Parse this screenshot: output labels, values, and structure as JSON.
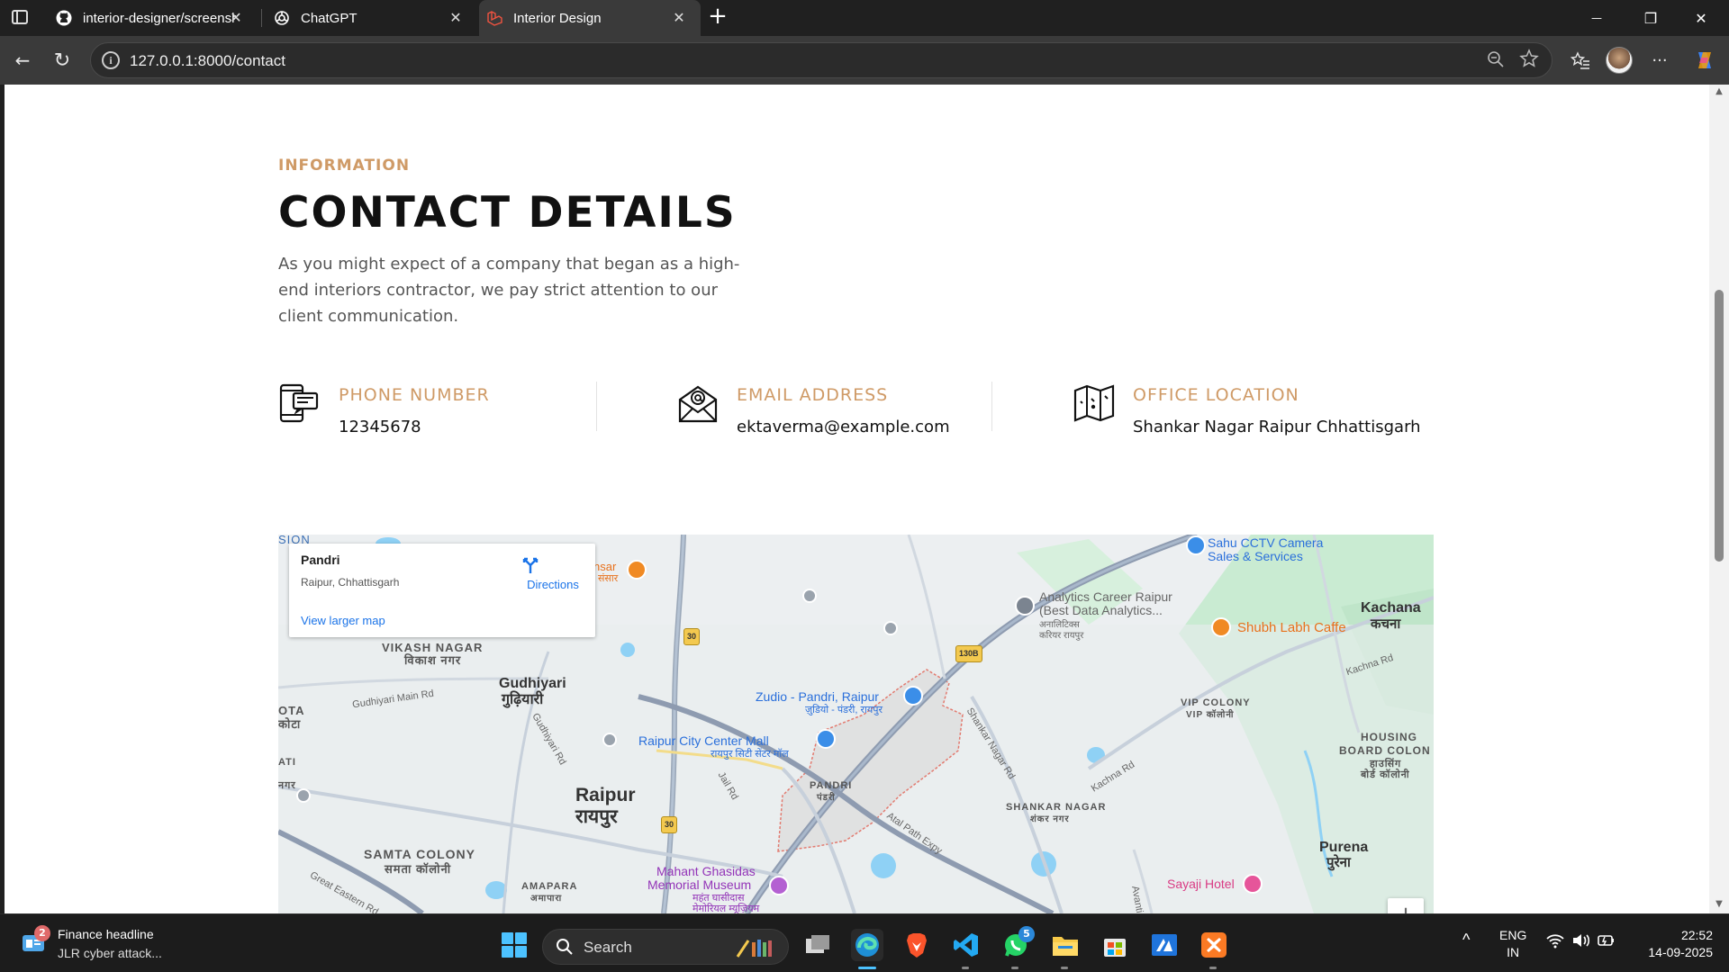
{
  "browser": {
    "tabs": [
      {
        "title": "interior-designer/screenshorts/Sc",
        "icon": "github-icon"
      },
      {
        "title": "ChatGPT",
        "icon": "chatgpt-icon"
      },
      {
        "title": "Interior Design",
        "icon": "laravel-icon"
      }
    ],
    "new_tab": "+",
    "url": "127.0.0.1:8000/contact",
    "window_controls": {
      "minimize": "—",
      "restore": "❐",
      "close": "✕"
    },
    "tab_close": "✕",
    "toolbar_icons": {
      "back": "←",
      "reload": "↻",
      "menu": "···"
    }
  },
  "page": {
    "eyebrow": "INFORMATION",
    "heading": "CONTACT DETAILS",
    "intro": "As you might expect of a company that began as a high-end interiors contractor, we pay strict attention to our client communication.",
    "contacts": [
      {
        "label": "PHONE NUMBER",
        "value": "12345678",
        "icon": "phone-icon"
      },
      {
        "label": "EMAIL ADDRESS",
        "value": "ektaverma@example.com",
        "icon": "email-icon"
      },
      {
        "label": "OFFICE LOCATION",
        "value": "Shankar Nagar Raipur Chhattisgarh",
        "icon": "map-icon"
      }
    ],
    "accent_color": "#cf9a66"
  },
  "map": {
    "card": {
      "place": "Pandri",
      "address": "Raipur, Chhattisgarh",
      "directions": "Directions",
      "larger_map": "View larger map"
    },
    "zoom_in": "+",
    "labels": {
      "sion": "SION",
      "vikash_nagar": "VIKASH NAGAR",
      "vikash_nagar_hi": "विकाश नगर",
      "gudhiyari": "Gudhiyari",
      "gudhiyari_hi": "गुढ़ियारी",
      "gudhiyari_main_rd": "Gudhiyari Main Rd",
      "gudhiyari_rd": "Gudhiyari Rd",
      "kota": "OTA",
      "kota_hi": "कोटा",
      "raipur": "Raipur",
      "raipur_hi": "रायपुर",
      "samta_colony": "SAMTA COLONY",
      "samta_colony_hi": "समता कॉलोनी",
      "amapara": "AMAPARA",
      "amapara_hi": "अमापारा",
      "great_eastern_rd": "Great Eastern Rd",
      "zudio": "Zudio - Pandri, Raipur",
      "zudio_hi": "ज़ुडियो - पंडरी, रायपुर",
      "city_center_mall": "Raipur City Center Mall",
      "city_center_mall_hi": "रायपुर सिटी सेंटर मॉल",
      "pandri": "PANDRI",
      "pandri_hi": "पंडरी",
      "jail_rd": "Jail Rd",
      "atal_path": "Atal Path Expy",
      "shankar_nagar_rd": "Shankar Nagar Rd",
      "shankar_nagar": "SHANKAR NAGAR",
      "shankar_nagar_hi": "शंकर नगर",
      "mahant": "Mahant Ghasidas",
      "mahant2": "Memorial Museum",
      "mahant_hi": "महंत घासीदास",
      "mahant_hi2": "मेमोरियल म्यूज़ियम",
      "analytics": "Analytics Career Raipur",
      "analytics2": "(Best Data Analytics...",
      "analytics_hi": "अनालिटिक्स",
      "analytics_hi2": "करियर रायपुर",
      "sahu": "Sahu CCTV Camera",
      "sahu2": "Sales & Services",
      "shubh": "Shubh Labh Caffe",
      "kachana": "Kachana",
      "kachana_hi": "कचना",
      "kachna_rd": "Kachna Rd",
      "vip_colony": "VIP COLONY",
      "vip_colony_hi": "VIP कॉलोनी",
      "housing_board": "HOUSING",
      "housing_board2": "BOARD COLON",
      "housing_board_hi": "हाउसिंग",
      "housing_board_hi2": "बोर्ड कॉलोनी",
      "kachna_rd2": "Kachna Rd",
      "purena": "Purena",
      "purena_hi": "पुरेना",
      "sayaji": "Sayaji Hotel",
      "sansar": "nsar",
      "sansar_hi": "संसार",
      "avanti": "Avanti",
      "nh30": "30",
      "nh30b": "30",
      "nh130b": "130B",
      "ati": "ATI",
      "nagar": "नगर"
    }
  },
  "taskbar": {
    "news_badge": "2",
    "news_title": "Finance headline",
    "news_sub": "JLR cyber attack...",
    "search": "Search",
    "whatsapp_badge": "5",
    "tray_arrow": "^",
    "lang1": "ENG",
    "lang2": "IN",
    "time": "22:52",
    "date": "14-09-2025"
  }
}
